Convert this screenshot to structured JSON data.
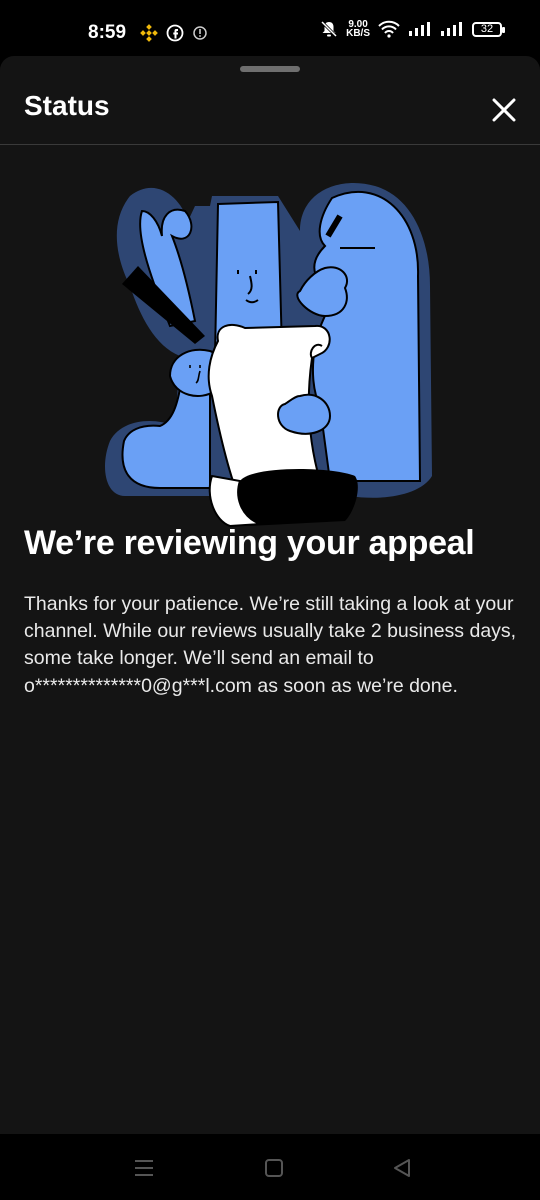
{
  "status_bar": {
    "time": "8:59",
    "speed_value": "9.00",
    "speed_unit": "KB/S",
    "battery": "32"
  },
  "sheet": {
    "title": "Status",
    "heading": "We’re reviewing your appeal",
    "body": "Thanks for your patience. We’re still taking a look at your channel. While our reviews usually take 2 business days, some take longer. We’ll send an email to o**************0@g***l.com as soon as we’re done."
  },
  "colors": {
    "illustration_blue": "#6aa0f5",
    "illustration_outline": "#2e4673",
    "sheet_background": "#141414"
  },
  "icons": [
    "binance-icon",
    "facebook-icon",
    "info-icon",
    "mute-icon",
    "wifi-icon",
    "signal-icon",
    "battery-icon",
    "close-icon",
    "menu-icon",
    "home-icon",
    "back-icon"
  ]
}
